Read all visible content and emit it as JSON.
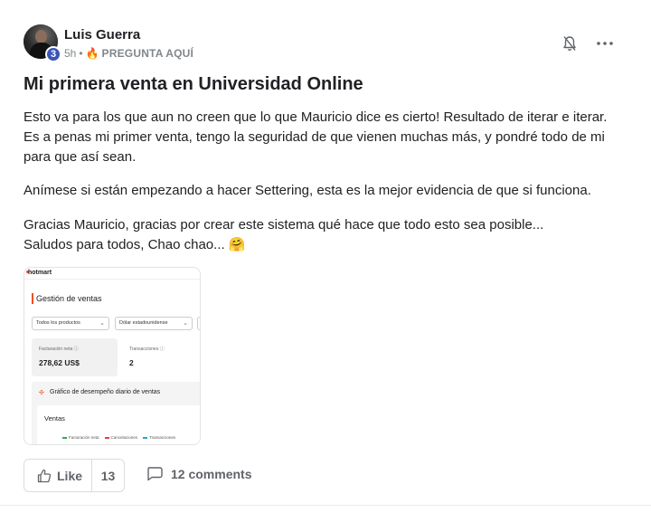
{
  "post": {
    "author": {
      "name": "Luis Guerra",
      "level": "3"
    },
    "meta": {
      "time": "5h",
      "separator": "•",
      "category_emoji": "🔥",
      "category": "PREGUNTA AQUÍ"
    },
    "title": "Mi primera venta en Universidad Online",
    "paragraphs": {
      "p1_line1": "Esto va para los que aun no creen que lo que Mauricio dice es cierto! Resultado de iterar e iterar.",
      "p1_line2": "Es a penas mi primer venta, tengo la seguridad de que vienen muchas más, y pondré todo de mi",
      "p1_line3": "para que así sean.",
      "p2": "Anímese si están empezando a hacer Settering, esta es la mejor evidencia de que si funciona.",
      "p3_line1": "Gracias Mauricio, gracias por crear este sistema qué hace que todo esto sea posible...",
      "p3_line2": "Saludos para todos, Chao chao... 🤗"
    },
    "attachment": {
      "brand": "hotmart",
      "heading": "Gestión de ventas",
      "filter_products": "Todos los productos",
      "filter_currency": "Dólar estadounidense",
      "card1_label": "Facturación neta",
      "card1_value": "278,62 US$",
      "card2_label": "Transacciones",
      "card2_value": "2",
      "panel_title": "Gráfico de desempeño diario de ventas",
      "panel_sub": "Ventas",
      "legend": [
        "Facturación neta",
        "Cancelaciones",
        "Transacciones"
      ],
      "legend_colors": [
        "#2eaa57",
        "#e0443a",
        "#2aa6d8"
      ]
    },
    "actions": {
      "like_label": "Like",
      "like_count": "13",
      "comments_label": "12 comments"
    },
    "icons": {
      "bell": "bell-off-icon",
      "more": "more-horizontal-icon",
      "like": "thumbs-up-icon",
      "comment": "comment-icon"
    }
  }
}
